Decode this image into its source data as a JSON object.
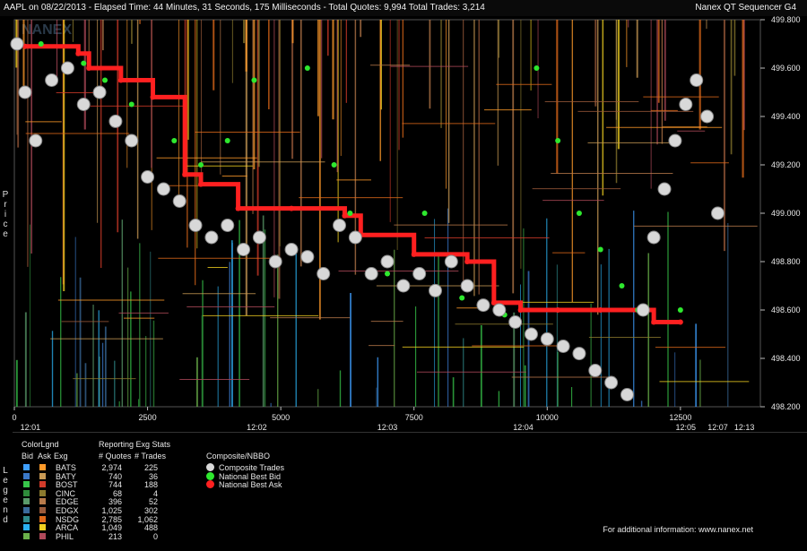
{
  "title": "AAPL on 08/22/2013  -  Elapsed Time: 44 Minutes, 31 Seconds, 175 Milliseconds  -  Total Quotes: 9,994  Total Trades: 3,214",
  "brand": "Nanex QT Sequencer G4",
  "watermark": "NANEX",
  "y_axis_label": "Price",
  "legend_side_label": "Legend",
  "footer": "For additional information: www.nanex.net",
  "legend": {
    "header_colorlgnd": "ColorLgnd",
    "header_bid": "Bid",
    "header_ask": "Ask",
    "header_exg": "Exg",
    "header_stats": "Reporting Exg Stats",
    "header_quotes": "# Quotes",
    "header_trades": "# Trades",
    "header_composite": "Composite/NBBO",
    "exchanges": [
      {
        "name": "BATS",
        "quotes": "2,974",
        "trades": "225",
        "bid_color": "#3fa0ff",
        "ask_color": "#ff9a2a"
      },
      {
        "name": "BATY",
        "quotes": "740",
        "trades": "36",
        "bid_color": "#3a78c8",
        "ask_color": "#c99a55"
      },
      {
        "name": "BOST",
        "quotes": "744",
        "trades": "188",
        "bid_color": "#37c64a",
        "ask_color": "#d23b2a"
      },
      {
        "name": "CINC",
        "quotes": "68",
        "trades": "4",
        "bid_color": "#2e8b3a",
        "ask_color": "#8b7a2e"
      },
      {
        "name": "EDGE",
        "quotes": "396",
        "trades": "52",
        "bid_color": "#5a9a6a",
        "ask_color": "#b87a4a"
      },
      {
        "name": "EDGX",
        "quotes": "1,025",
        "trades": "302",
        "bid_color": "#3a6a9a",
        "ask_color": "#9a5a3a"
      },
      {
        "name": "NSDG",
        "quotes": "2,785",
        "trades": "1,062",
        "bid_color": "#2f8a8a",
        "ask_color": "#e06a1a"
      },
      {
        "name": "ARCA",
        "quotes": "1,049",
        "trades": "488",
        "bid_color": "#2ab0f0",
        "ask_color": "#f0d020"
      },
      {
        "name": "PHIL",
        "quotes": "213",
        "trades": "0",
        "bid_color": "#6ab04a",
        "ask_color": "#b04a5a"
      }
    ],
    "composite": [
      {
        "label": "Composite Trades",
        "color": "#d8d8d8"
      },
      {
        "label": "National Best Bid",
        "color": "#2ee82e"
      },
      {
        "label": "National Best Ask",
        "color": "#ff2020"
      }
    ]
  },
  "chart_data": {
    "type": "scatter",
    "title": "AAPL on 08/22/2013",
    "ylabel": "Price",
    "ylim": [
      498.2,
      499.8
    ],
    "yticks": [
      "499.800",
      "499.600",
      "499.400",
      "499.200",
      "499.000",
      "498.800",
      "498.600",
      "498.400",
      "498.200"
    ],
    "yticks_values": [
      499.8,
      499.6,
      499.4,
      499.2,
      499.0,
      498.8,
      498.6,
      498.4,
      498.2
    ],
    "xlim": [
      0,
      14000
    ],
    "xticks_seq": [
      "0",
      "2500",
      "5000",
      "7500",
      "10000",
      "12500"
    ],
    "xticks_seq_values": [
      0,
      2500,
      5000,
      7500,
      10000,
      12500
    ],
    "xticks_time": [
      "12:01",
      "12:02",
      "12:03",
      "12:04",
      "12:05",
      "12:07",
      "12:13"
    ],
    "xticks_time_values": [
      300,
      4550,
      7000,
      9550,
      12600,
      13200,
      13700
    ],
    "grid": false,
    "series": [
      {
        "name": "National Best Ask",
        "color": "#ff2020",
        "x": [
          200,
          1200,
          1400,
          2000,
          2600,
          3200,
          3500,
          4200,
          5200,
          6200,
          6500,
          7500,
          8500,
          9000,
          9500,
          10200,
          11000,
          12000,
          12500
        ],
        "y": [
          499.69,
          499.66,
          499.6,
          499.55,
          499.48,
          499.16,
          499.12,
          499.02,
          499.02,
          498.99,
          498.91,
          498.83,
          498.8,
          498.63,
          498.6,
          498.6,
          498.6,
          498.55,
          498.55
        ]
      },
      {
        "name": "National Best Bid",
        "color": "#2ee82e",
        "x": [
          500,
          1300,
          1700,
          2200,
          3000,
          3500,
          4000,
          4500,
          5500,
          6000,
          6300,
          7000,
          7700,
          8400,
          9200,
          9800,
          10200,
          10600,
          11000,
          11400,
          11700,
          12000,
          12500
        ],
        "y": [
          499.7,
          499.62,
          499.55,
          499.45,
          499.3,
          499.2,
          499.3,
          499.55,
          499.6,
          499.2,
          499.0,
          498.75,
          499.0,
          498.65,
          498.58,
          499.6,
          499.3,
          499.0,
          498.85,
          498.7,
          498.6,
          498.9,
          498.6
        ]
      },
      {
        "name": "Composite Trades",
        "color": "#d8d8d8",
        "x": [
          50,
          200,
          400,
          700,
          1000,
          1300,
          1600,
          1900,
          2200,
          2500,
          2800,
          3100,
          3400,
          3700,
          4000,
          4300,
          4600,
          4900,
          5200,
          5500,
          5800,
          6100,
          6400,
          6700,
          7000,
          7300,
          7600,
          7900,
          8200,
          8500,
          8800,
          9100,
          9400,
          9700,
          10000,
          10300,
          10600,
          10900,
          11200,
          11500,
          11800,
          12000,
          12200,
          12400,
          12600,
          12800,
          13000,
          13200
        ],
        "y": [
          499.7,
          499.5,
          499.3,
          499.55,
          499.6,
          499.45,
          499.5,
          499.38,
          499.3,
          499.15,
          499.1,
          499.05,
          498.95,
          498.9,
          498.95,
          498.85,
          498.9,
          498.8,
          498.85,
          498.82,
          498.75,
          498.95,
          498.9,
          498.75,
          498.8,
          498.7,
          498.75,
          498.68,
          498.8,
          498.7,
          498.62,
          498.6,
          498.55,
          498.5,
          498.48,
          498.45,
          498.42,
          498.35,
          498.3,
          498.25,
          498.6,
          498.9,
          499.1,
          499.3,
          499.45,
          499.55,
          499.4,
          499.0
        ]
      }
    ]
  }
}
